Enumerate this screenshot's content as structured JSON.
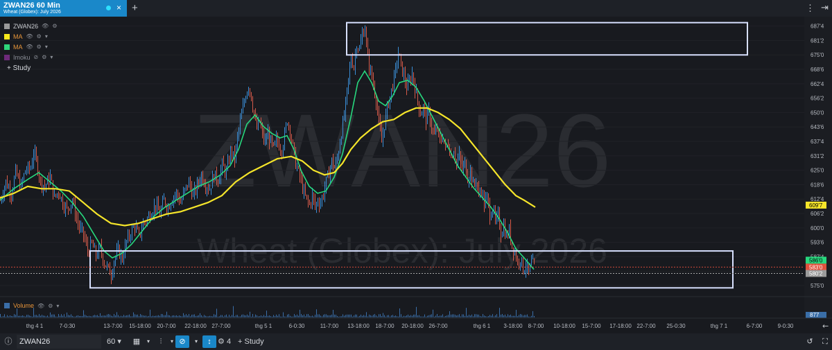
{
  "tab": {
    "title": "ZWAN26 60 Min",
    "subtitle": "Wheat (Globex): July 2026",
    "close": "×",
    "add": "+"
  },
  "menu": {
    "dots": "⋮",
    "collapse": "⇥"
  },
  "legend": [
    {
      "label": "ZWAN26",
      "color": "#9a9a9a"
    },
    {
      "label": "MA",
      "color": "#f7e81c"
    },
    {
      "label": "MA",
      "color": "#2ed67a"
    },
    {
      "label": "Imoku",
      "color": "#6e2a7a"
    }
  ],
  "study_label": "+ Study",
  "volume_label": "Volume",
  "volume_value": "877",
  "watermark": {
    "symbol": "ZWAN26",
    "name": "Wheat (Globex): July 2026"
  },
  "price_badges": {
    "ma_yellow": "609'7",
    "ma_green": "586'0",
    "last": "583'0",
    "low": "580'2"
  },
  "bottom": {
    "symbol": "ZWAN26",
    "interval": "60",
    "studies_count": "4",
    "study": "+ Study"
  },
  "colors": {
    "candle": "#3a8ed6",
    "candle_down": "#d55a4a",
    "ma_slow": "#f5e52a",
    "ma_fast": "#27d87e",
    "box": "#d8e0ff",
    "volume": "#3a6ea8"
  },
  "chart_data": {
    "type": "candlestick",
    "price_axis_ticks": [
      "687'4",
      "681'2",
      "675'0",
      "668'6",
      "662'4",
      "656'2",
      "650'0",
      "643'6",
      "637'4",
      "631'2",
      "625'0",
      "618'6",
      "612'4",
      "606'2",
      "600'0",
      "593'6",
      "587'4",
      "581'2",
      "575'0"
    ],
    "time_axis_labels": [
      "thg 4 1",
      "7-0:30",
      "13-7:00",
      "15-18:00",
      "20-7:00",
      "22-18:00",
      "27-7:00",
      "thg 5 1",
      "6-0:30",
      "11-7:00",
      "13-18:00",
      "18-7:00",
      "20-18:00",
      "26-7:00",
      "thg 6 1",
      "3-18:00",
      "8-7:00",
      "10-18:00",
      "15-7:00",
      "17-18:00",
      "22-7:00",
      "25-0:30",
      "thg 7 1",
      "6-7:00",
      "9-0:30"
    ],
    "close_path": [
      [
        0,
        612
      ],
      [
        8,
        620
      ],
      [
        16,
        615
      ],
      [
        22,
        624
      ],
      [
        30,
        618
      ],
      [
        36,
        625
      ],
      [
        44,
        626
      ],
      [
        48,
        633
      ],
      [
        52,
        629
      ],
      [
        58,
        620
      ],
      [
        64,
        618
      ],
      [
        72,
        622
      ],
      [
        78,
        613
      ],
      [
        84,
        616
      ],
      [
        90,
        611
      ],
      [
        96,
        608
      ],
      [
        104,
        612
      ],
      [
        110,
        604
      ],
      [
        114,
        600
      ],
      [
        120,
        597
      ],
      [
        126,
        590
      ],
      [
        132,
        593
      ],
      [
        138,
        588
      ],
      [
        144,
        591
      ],
      [
        150,
        585
      ],
      [
        156,
        582
      ],
      [
        160,
        580
      ],
      [
        164,
        586
      ],
      [
        170,
        590
      ],
      [
        176,
        587
      ],
      [
        182,
        594
      ],
      [
        188,
        598
      ],
      [
        194,
        601
      ],
      [
        200,
        596
      ],
      [
        206,
        602
      ],
      [
        212,
        604
      ],
      [
        218,
        607
      ],
      [
        224,
        610
      ],
      [
        230,
        606
      ],
      [
        236,
        612
      ],
      [
        242,
        609
      ],
      [
        248,
        613
      ],
      [
        254,
        615
      ],
      [
        260,
        611
      ],
      [
        266,
        616
      ],
      [
        272,
        620
      ],
      [
        278,
        614
      ],
      [
        284,
        618
      ],
      [
        290,
        623
      ],
      [
        296,
        619
      ],
      [
        302,
        617
      ],
      [
        308,
        623
      ],
      [
        314,
        621
      ],
      [
        320,
        627
      ],
      [
        326,
        624
      ],
      [
        332,
        633
      ],
      [
        338,
        630
      ],
      [
        342,
        639
      ],
      [
        346,
        646
      ],
      [
        350,
        652
      ],
      [
        354,
        658
      ],
      [
        358,
        662
      ],
      [
        362,
        657
      ],
      [
        366,
        649
      ],
      [
        370,
        643
      ],
      [
        374,
        646
      ],
      [
        378,
        640
      ],
      [
        382,
        637
      ],
      [
        386,
        641
      ],
      [
        390,
        637
      ],
      [
        394,
        634
      ],
      [
        398,
        638
      ],
      [
        402,
        636
      ],
      [
        406,
        634
      ],
      [
        410,
        640
      ],
      [
        414,
        647
      ],
      [
        418,
        642
      ],
      [
        422,
        635
      ],
      [
        426,
        628
      ],
      [
        430,
        624
      ],
      [
        434,
        620
      ],
      [
        438,
        615
      ],
      [
        442,
        612
      ],
      [
        446,
        610
      ],
      [
        450,
        614
      ],
      [
        454,
        609
      ],
      [
        458,
        612
      ],
      [
        462,
        611
      ],
      [
        466,
        615
      ],
      [
        470,
        620
      ],
      [
        474,
        624
      ],
      [
        478,
        629
      ],
      [
        482,
        626
      ],
      [
        486,
        630
      ],
      [
        490,
        638
      ],
      [
        494,
        645
      ],
      [
        498,
        653
      ],
      [
        502,
        664
      ],
      [
        506,
        674
      ],
      [
        510,
        670
      ],
      [
        514,
        680
      ],
      [
        518,
        677
      ],
      [
        522,
        684
      ],
      [
        526,
        687
      ],
      [
        530,
        673
      ],
      [
        534,
        668
      ],
      [
        538,
        662
      ],
      [
        542,
        656
      ],
      [
        546,
        645
      ],
      [
        550,
        637
      ],
      [
        554,
        645
      ],
      [
        558,
        652
      ],
      [
        562,
        657
      ],
      [
        566,
        662
      ],
      [
        570,
        668
      ],
      [
        574,
        676
      ],
      [
        578,
        670
      ],
      [
        582,
        666
      ],
      [
        586,
        661
      ],
      [
        590,
        663
      ],
      [
        594,
        667
      ],
      [
        598,
        661
      ],
      [
        602,
        655
      ],
      [
        606,
        650
      ],
      [
        610,
        652
      ],
      [
        614,
        647
      ],
      [
        618,
        650
      ],
      [
        622,
        644
      ],
      [
        626,
        640
      ],
      [
        630,
        643
      ],
      [
        634,
        637
      ],
      [
        638,
        640
      ],
      [
        642,
        634
      ],
      [
        646,
        637
      ],
      [
        650,
        631
      ],
      [
        654,
        634
      ],
      [
        658,
        628
      ],
      [
        662,
        631
      ],
      [
        666,
        625
      ],
      [
        670,
        628
      ],
      [
        674,
        622
      ],
      [
        678,
        625
      ],
      [
        682,
        618
      ],
      [
        686,
        621
      ],
      [
        690,
        614
      ],
      [
        694,
        617
      ],
      [
        698,
        610
      ],
      [
        702,
        613
      ],
      [
        706,
        606
      ],
      [
        710,
        609
      ],
      [
        714,
        602
      ],
      [
        718,
        605
      ],
      [
        722,
        598
      ],
      [
        726,
        601
      ],
      [
        730,
        596
      ],
      [
        734,
        599
      ],
      [
        738,
        592
      ],
      [
        742,
        590
      ],
      [
        746,
        585
      ],
      [
        750,
        587
      ],
      [
        754,
        582
      ],
      [
        758,
        584
      ],
      [
        762,
        580
      ],
      [
        766,
        585
      ],
      [
        770,
        583
      ],
      [
        772,
        581
      ]
    ],
    "ma_fast_path": [
      [
        0,
        612
      ],
      [
        20,
        617
      ],
      [
        40,
        621
      ],
      [
        56,
        624
      ],
      [
        72,
        620
      ],
      [
        88,
        616
      ],
      [
        104,
        611
      ],
      [
        120,
        605
      ],
      [
        136,
        597
      ],
      [
        150,
        590
      ],
      [
        162,
        587
      ],
      [
        176,
        589
      ],
      [
        190,
        593
      ],
      [
        206,
        599
      ],
      [
        222,
        605
      ],
      [
        238,
        609
      ],
      [
        254,
        612
      ],
      [
        270,
        615
      ],
      [
        286,
        618
      ],
      [
        302,
        620
      ],
      [
        318,
        623
      ],
      [
        332,
        627
      ],
      [
        344,
        634
      ],
      [
        356,
        645
      ],
      [
        368,
        649
      ],
      [
        380,
        644
      ],
      [
        392,
        641
      ],
      [
        404,
        639
      ],
      [
        414,
        640
      ],
      [
        424,
        634
      ],
      [
        434,
        625
      ],
      [
        446,
        618
      ],
      [
        458,
        615
      ],
      [
        470,
        616
      ],
      [
        482,
        622
      ],
      [
        494,
        632
      ],
      [
        506,
        648
      ],
      [
        516,
        663
      ],
      [
        526,
        668
      ],
      [
        536,
        663
      ],
      [
        546,
        655
      ],
      [
        556,
        653
      ],
      [
        566,
        657
      ],
      [
        576,
        663
      ],
      [
        588,
        664
      ],
      [
        600,
        661
      ],
      [
        612,
        655
      ],
      [
        624,
        648
      ],
      [
        636,
        641
      ],
      [
        648,
        634
      ],
      [
        660,
        627
      ],
      [
        672,
        622
      ],
      [
        684,
        617
      ],
      [
        696,
        613
      ],
      [
        708,
        609
      ],
      [
        720,
        604
      ],
      [
        732,
        598
      ],
      [
        744,
        591
      ],
      [
        756,
        587
      ],
      [
        770,
        582
      ]
    ],
    "ma_slow_path": [
      [
        0,
        613
      ],
      [
        20,
        615
      ],
      [
        40,
        618
      ],
      [
        60,
        617
      ],
      [
        80,
        617
      ],
      [
        100,
        616
      ],
      [
        120,
        611
      ],
      [
        140,
        606
      ],
      [
        160,
        602
      ],
      [
        180,
        601
      ],
      [
        200,
        602
      ],
      [
        220,
        604
      ],
      [
        240,
        606
      ],
      [
        260,
        607
      ],
      [
        280,
        609
      ],
      [
        300,
        611
      ],
      [
        320,
        614
      ],
      [
        340,
        620
      ],
      [
        360,
        624
      ],
      [
        380,
        627
      ],
      [
        400,
        630
      ],
      [
        420,
        631
      ],
      [
        436,
        629
      ],
      [
        452,
        625
      ],
      [
        468,
        623
      ],
      [
        482,
        624
      ],
      [
        494,
        628
      ],
      [
        506,
        634
      ],
      [
        520,
        639
      ],
      [
        536,
        643
      ],
      [
        552,
        646
      ],
      [
        568,
        647
      ],
      [
        584,
        650
      ],
      [
        600,
        652
      ],
      [
        616,
        652
      ],
      [
        632,
        650
      ],
      [
        648,
        647
      ],
      [
        664,
        643
      ],
      [
        680,
        637
      ],
      [
        696,
        631
      ],
      [
        712,
        625
      ],
      [
        728,
        619
      ],
      [
        744,
        614
      ],
      [
        756,
        612
      ],
      [
        772,
        609
      ]
    ],
    "annotation_boxes": [
      {
        "price_top": 689,
        "price_bottom": 675,
        "label": ""
      },
      {
        "price_top": 590,
        "price_bottom": 574,
        "label": ""
      }
    ],
    "reference_lines": [
      {
        "price": 583,
        "style": "dotted",
        "color": "#d44a3a"
      },
      {
        "price": 580.25,
        "style": "dotted",
        "color": "#aaaaaa"
      }
    ],
    "y_range": [
      572,
      691
    ]
  }
}
